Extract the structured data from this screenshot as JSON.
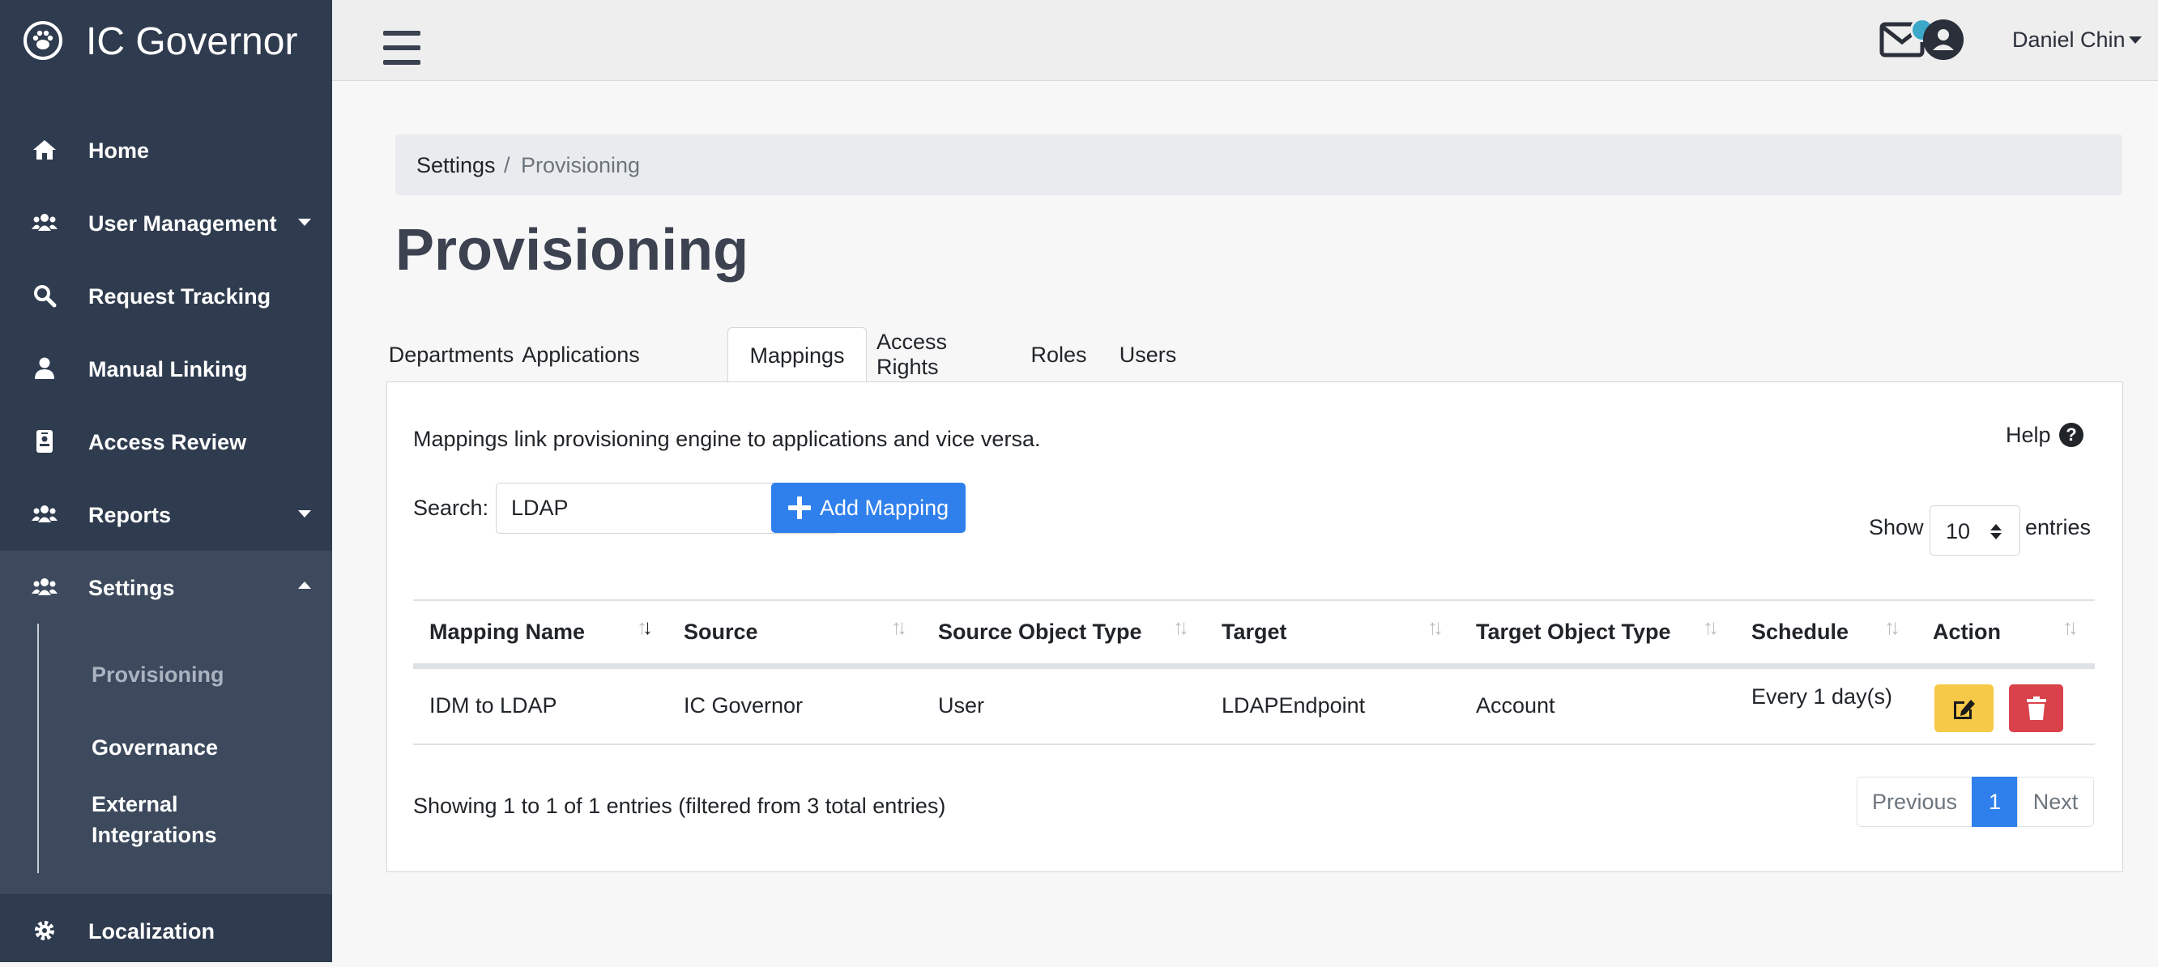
{
  "app": {
    "name": "IC Governor"
  },
  "sidebar": {
    "items": [
      {
        "label": "Home",
        "icon": "home-icon"
      },
      {
        "label": "User Management",
        "icon": "users-icon"
      },
      {
        "label": "Request Tracking",
        "icon": "search-icon"
      },
      {
        "label": "Manual Linking",
        "icon": "user-icon"
      },
      {
        "label": "Access Review",
        "icon": "id-badge-icon"
      },
      {
        "label": "Reports",
        "icon": "users-icon"
      },
      {
        "label": "Settings",
        "icon": "users-icon"
      },
      {
        "label": "Localization",
        "icon": "gear-icon"
      }
    ],
    "settings_sub": [
      "Provisioning",
      "Governance",
      "External\nIntegrations"
    ]
  },
  "topbar": {
    "user_name": "Daniel Chin"
  },
  "breadcrumb": {
    "settings": "Settings",
    "separator": "/",
    "current": "Provisioning"
  },
  "page": {
    "title": "Provisioning"
  },
  "tabs": [
    "Departments",
    "Applications",
    "Mappings",
    "Access Rights",
    "Roles",
    "Users"
  ],
  "panel": {
    "description": "Mappings link provisioning engine to applications and vice versa.",
    "help": "Help",
    "help_glyph": "?",
    "search_label": "Search:",
    "search_value": "LDAP",
    "add_button": "Add Mapping",
    "show_label": "Show",
    "entries_value": "10",
    "entries_label": "entries"
  },
  "table": {
    "columns": [
      "Mapping Name",
      "Source",
      "Source Object Type",
      "Target",
      "Target Object Type",
      "Schedule",
      "Action"
    ],
    "rows": [
      {
        "mapping_name": "IDM to LDAP",
        "source": "IC Governor",
        "source_object_type": "User",
        "target": "LDAPEndpoint",
        "target_object_type": "Account",
        "schedule": "Every 1 day(s)"
      }
    ],
    "info": "Showing 1 to 1 of 1 entries (filtered from 3 total entries)"
  },
  "pagination": {
    "previous": "Previous",
    "current": "1",
    "next": "Next"
  },
  "colors": {
    "sidebar": "#2f3b4e",
    "primary": "#2f80ed",
    "warning": "#f7c948",
    "danger": "#d9424b",
    "notification": "#3ba7c9"
  }
}
